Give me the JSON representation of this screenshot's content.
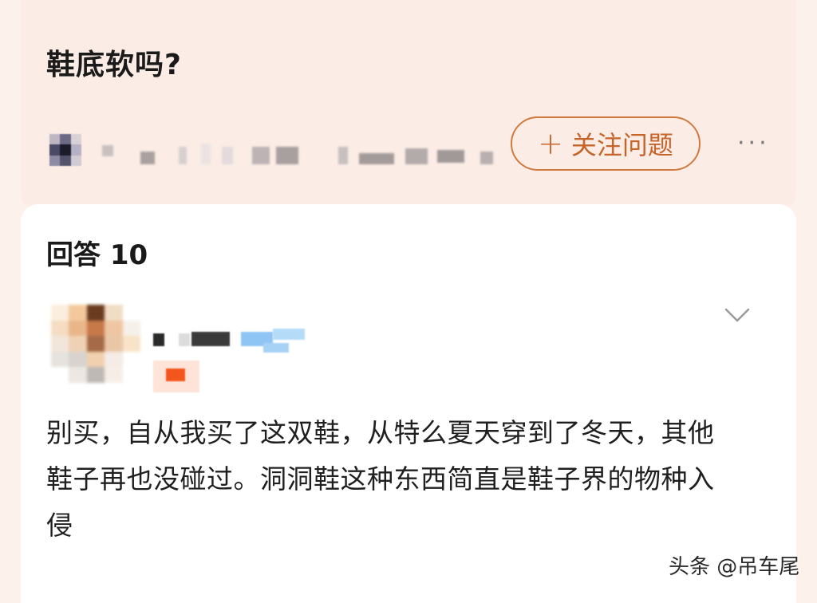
{
  "question": {
    "title": "鞋底软吗?"
  },
  "asker": {
    "avatar_icon": "blurred-avatar",
    "name_blurred": true
  },
  "actions": {
    "follow_label": "关注问题",
    "follow_icon": "plus-icon",
    "more_icon": "more-dots-icon",
    "accent_color": "#d2793f"
  },
  "answers": {
    "header": "回答 10"
  },
  "answer": {
    "author_blurred": true,
    "collapse_icon": "chevron-down-icon",
    "body": "别买，自从我买了这双鞋，从特么夏天穿到了冬天，其他鞋子再也没碰过。洞洞鞋这种东西简直是鞋子界的物种入侵"
  },
  "watermark": {
    "text": "头条 @吊车尾"
  }
}
